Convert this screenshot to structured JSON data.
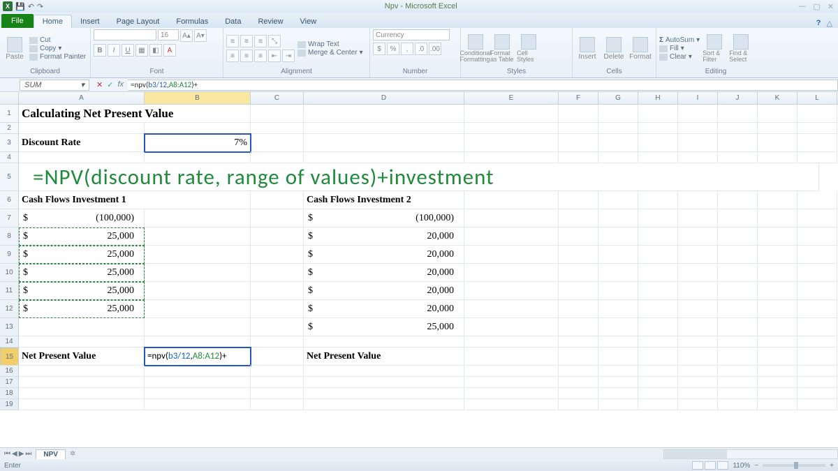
{
  "titlebar": {
    "title": "Npv - Microsoft Excel",
    "excel_letter": "X"
  },
  "tabs": {
    "file": "File",
    "home": "Home",
    "insert": "Insert",
    "page_layout": "Page Layout",
    "formulas": "Formulas",
    "data": "Data",
    "review": "Review",
    "view": "View"
  },
  "ribbon": {
    "clipboard": {
      "label": "Clipboard",
      "paste": "Paste",
      "cut": "Cut",
      "copy": "Copy",
      "fp": "Format Painter"
    },
    "font": {
      "label": "Font",
      "size": "16",
      "bold": "B",
      "italic": "I",
      "underline": "U"
    },
    "alignment": {
      "label": "Alignment",
      "wrap": "Wrap Text",
      "merge": "Merge & Center"
    },
    "number": {
      "label": "Number",
      "format": "Currency"
    },
    "styles": {
      "label": "Styles",
      "cond": "Conditional\nFormatting",
      "table": "Format\nas Table",
      "cell": "Cell\nStyles"
    },
    "cells": {
      "label": "Cells",
      "insert": "Insert",
      "delete": "Delete",
      "format": "Format"
    },
    "editing": {
      "label": "Editing",
      "autosum": "AutoSum",
      "fill": "Fill",
      "clear": "Clear",
      "sort": "Sort &\nFilter",
      "find": "Find &\nSelect"
    }
  },
  "fx": {
    "name": "SUM",
    "formula_prefix": "=npv(",
    "ref1": "b3/12",
    "sep": ",",
    "ref2": "A8:A12",
    "suffix": ")+"
  },
  "cols": [
    "A",
    "B",
    "C",
    "D",
    "E",
    "F",
    "G",
    "H",
    "I",
    "J",
    "K",
    "L"
  ],
  "rows": [
    "1",
    "2",
    "3",
    "4",
    "5",
    "6",
    "7",
    "8",
    "9",
    "10",
    "11",
    "12",
    "13",
    "14",
    "15",
    "16",
    "17",
    "18",
    "19"
  ],
  "sheet": {
    "title": "Calculating Net Present Value",
    "discount_label": "Discount Rate",
    "discount_value": "7%",
    "overlay": "=NPV(discount rate, range of values)+investment",
    "cf1_header": "Cash Flows Investment 1",
    "cf2_header": "Cash Flows Investment 2",
    "sym": "$",
    "cf1": [
      "(100,000)",
      "25,000",
      "25,000",
      "25,000",
      "25,000",
      "25,000",
      ""
    ],
    "cf2": [
      "(100,000)",
      "20,000",
      "20,000",
      "20,000",
      "20,000",
      "20,000",
      "25,000"
    ],
    "npv_label": "Net Present Value",
    "edit_prefix": "=npv(",
    "edit_ref1": "b3/12",
    "edit_sep": ",",
    "edit_ref2": "A8:A12",
    "edit_suffix": ")+"
  },
  "sheettab": "NPV",
  "status": {
    "mode": "Enter",
    "zoom": "110%"
  }
}
